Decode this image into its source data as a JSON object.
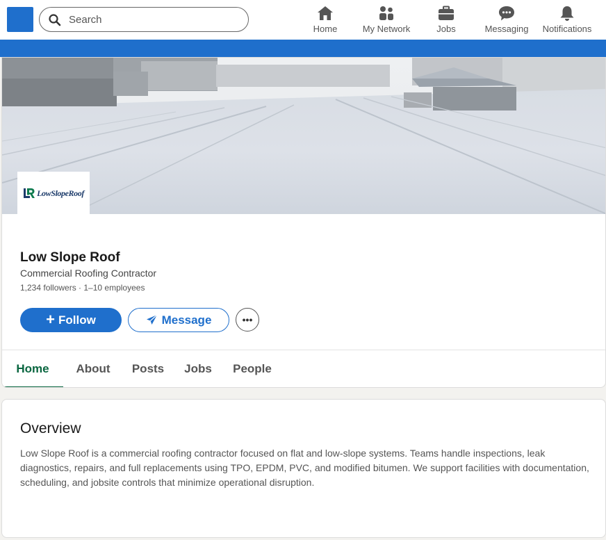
{
  "search": {
    "placeholder": "Search"
  },
  "nav": {
    "home": "Home",
    "network": "My Network",
    "jobs": "Jobs",
    "messaging": "Messaging",
    "notifications": "Notifications"
  },
  "company": {
    "logo_text": "LowSlopeRoof",
    "name": "Low Slope Roof",
    "tagline": "Commercial Roofing Contractor",
    "meta": "1,234 followers · 1–10 employees"
  },
  "actions": {
    "follow": "Follow",
    "message": "Message",
    "more": "•••"
  },
  "tabs": [
    "Home",
    "About",
    "Posts",
    "Jobs",
    "People"
  ],
  "overview": {
    "title": "Overview",
    "text": "Low Slope Roof is a commercial roofing contractor focused on flat and low-slope systems. Teams handle inspections, leak diagnostics, repairs, and full replacements using TPO, EPDM, PVC, and modified bitumen. We support facilities with documentation, scheduling, and jobsite controls that minimize operational disruption."
  },
  "colors": {
    "brand_blue": "#1f6fcc",
    "active_tab_green": "#0a6640",
    "page_background": "#f3f2ef"
  },
  "icons": [
    "search-icon",
    "home-icon",
    "my-network-icon",
    "jobs-icon",
    "messaging-icon",
    "notifications-icon",
    "send-icon",
    "plus-icon",
    "more-icon"
  ]
}
